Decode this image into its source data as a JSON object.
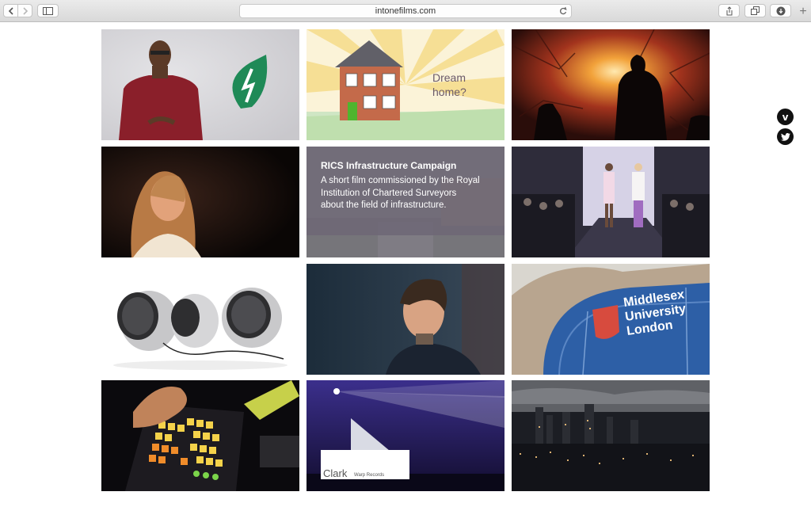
{
  "browser": {
    "url": "intonefilms.com"
  },
  "tiles": {
    "dream": {
      "line1": "Dream",
      "line2": "home?"
    },
    "rics": {
      "title": "RICS Infrastructure Campaign",
      "desc1": "A short film commissioned by the Royal",
      "desc2": "Institution of Chartered Surveyors",
      "desc3": "about the field of infrastructure."
    },
    "middlesex": {
      "line1": "Middlesex",
      "line2": "University",
      "line3": "London"
    },
    "clark": {
      "artist": "Clark",
      "label": "Warp Records"
    }
  },
  "social": {
    "vimeo_glyph": "v",
    "twitter_icon": "twitter-icon",
    "vimeo_icon": "vimeo-icon"
  },
  "colors": {
    "leaf": "#1f8a57",
    "caption_overlay": "#6e6876",
    "launchpad_yellow": "#f4d24a"
  }
}
